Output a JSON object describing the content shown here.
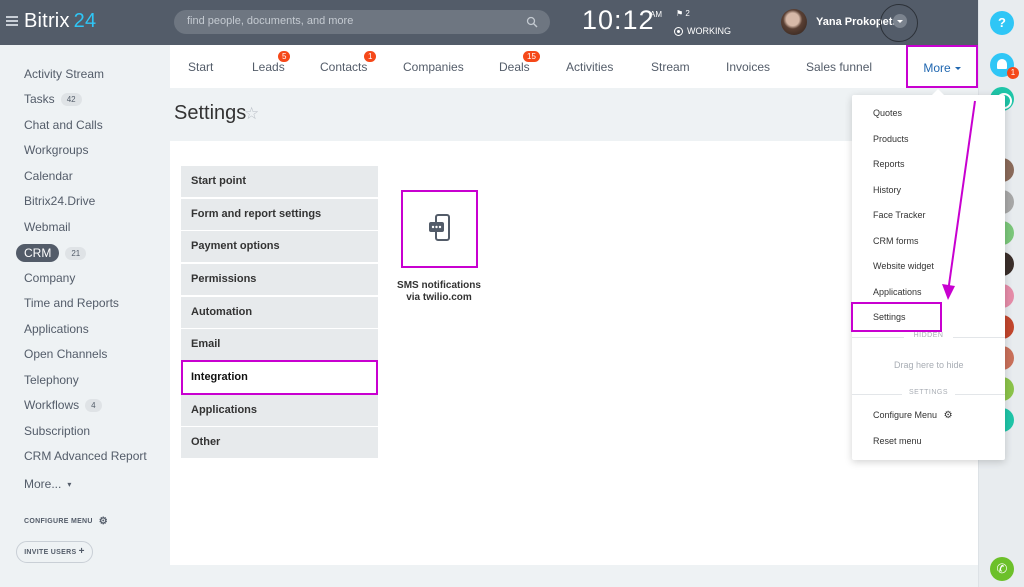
{
  "header": {
    "logo_brand": "Bitrix",
    "logo_number": "24",
    "search_placeholder": "find people, documents, and more",
    "time": "10:12",
    "ampm": "AM",
    "flag_count": "2",
    "status": "WORKING",
    "user_name": "Yana Prokopets"
  },
  "left_menu": {
    "items": [
      {
        "label": "Activity Stream"
      },
      {
        "label": "Tasks",
        "counter": "42"
      },
      {
        "label": "Chat and Calls"
      },
      {
        "label": "Workgroups"
      },
      {
        "label": "Calendar"
      },
      {
        "label": "Bitrix24.Drive"
      },
      {
        "label": "Webmail"
      },
      {
        "label": "CRM",
        "counter": "21"
      },
      {
        "label": "Company"
      },
      {
        "label": "Time and Reports"
      },
      {
        "label": "Applications"
      },
      {
        "label": "Open Channels"
      },
      {
        "label": "Telephony"
      },
      {
        "label": "Workflows",
        "counter": "4"
      },
      {
        "label": "Subscription"
      },
      {
        "label": "CRM Advanced Report"
      },
      {
        "label": "More..."
      }
    ],
    "configure_menu": "CONFIGURE MENU",
    "invite_users": "INVITE USERS"
  },
  "tabs": [
    {
      "label": "Start"
    },
    {
      "label": "Leads",
      "badge": "5"
    },
    {
      "label": "Contacts",
      "badge": "1"
    },
    {
      "label": "Companies"
    },
    {
      "label": "Deals",
      "badge": "15"
    },
    {
      "label": "Activities"
    },
    {
      "label": "Stream"
    },
    {
      "label": "Invoices"
    },
    {
      "label": "Sales funnel"
    },
    {
      "label": "More"
    }
  ],
  "page": {
    "title": "Settings"
  },
  "categories": [
    {
      "label": "Start point"
    },
    {
      "label": "Form and report settings"
    },
    {
      "label": "Payment options"
    },
    {
      "label": "Permissions"
    },
    {
      "label": "Automation"
    },
    {
      "label": "Email"
    },
    {
      "label": "Integration",
      "active": true
    },
    {
      "label": "Applications"
    },
    {
      "label": "Other"
    }
  ],
  "app_tile": {
    "caption_line1": "SMS notifications",
    "caption_line2": "via twilio.com"
  },
  "dropdown": {
    "items": [
      {
        "label": "Quotes"
      },
      {
        "label": "Products"
      },
      {
        "label": "Reports"
      },
      {
        "label": "History"
      },
      {
        "label": "Face Tracker"
      },
      {
        "label": "CRM forms"
      },
      {
        "label": "Website widget"
      },
      {
        "label": "Applications"
      },
      {
        "label": "Settings"
      }
    ],
    "hidden_label": "HIDDEN",
    "drag_hint": "Drag here to hide",
    "settings_label": "SETTINGS",
    "configure_menu": "Configure Menu",
    "reset_menu": "Reset menu"
  },
  "rail": {
    "help": "?",
    "notifications_count": "1"
  },
  "colors": {
    "header_bg": "#535c69",
    "accent_blue": "#2fc6f6",
    "highlight_magenta": "#c800d0",
    "badge_red": "#f54819",
    "link_blue": "#2067b0"
  }
}
